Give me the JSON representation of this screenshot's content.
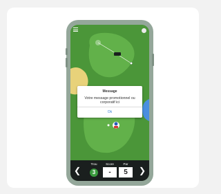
{
  "dialog": {
    "title": "Message",
    "message": "Votre message promotionnel ou corporatif ici",
    "ok_label": "Ok"
  },
  "scorecard": {
    "hole_label": "Trou",
    "score_label": "Score",
    "par_label": "Par",
    "hole_value": "3",
    "score_value": "-",
    "par_value": "5"
  },
  "icons": {
    "menu": "menu-icon",
    "settings": "settings-icon",
    "prev": "chevron-left-icon",
    "next": "chevron-right-icon",
    "flag": "flag-icon",
    "golfer": "golfer-icon"
  },
  "colors": {
    "rough": "#4b9639",
    "fairway": "#62b14a",
    "sand": "#e8d27a",
    "water": "#4a8fe0",
    "hole_badge": "#3a9a3e",
    "scorebar": "#1a1f1e",
    "phone_frame": "#94a79a"
  }
}
